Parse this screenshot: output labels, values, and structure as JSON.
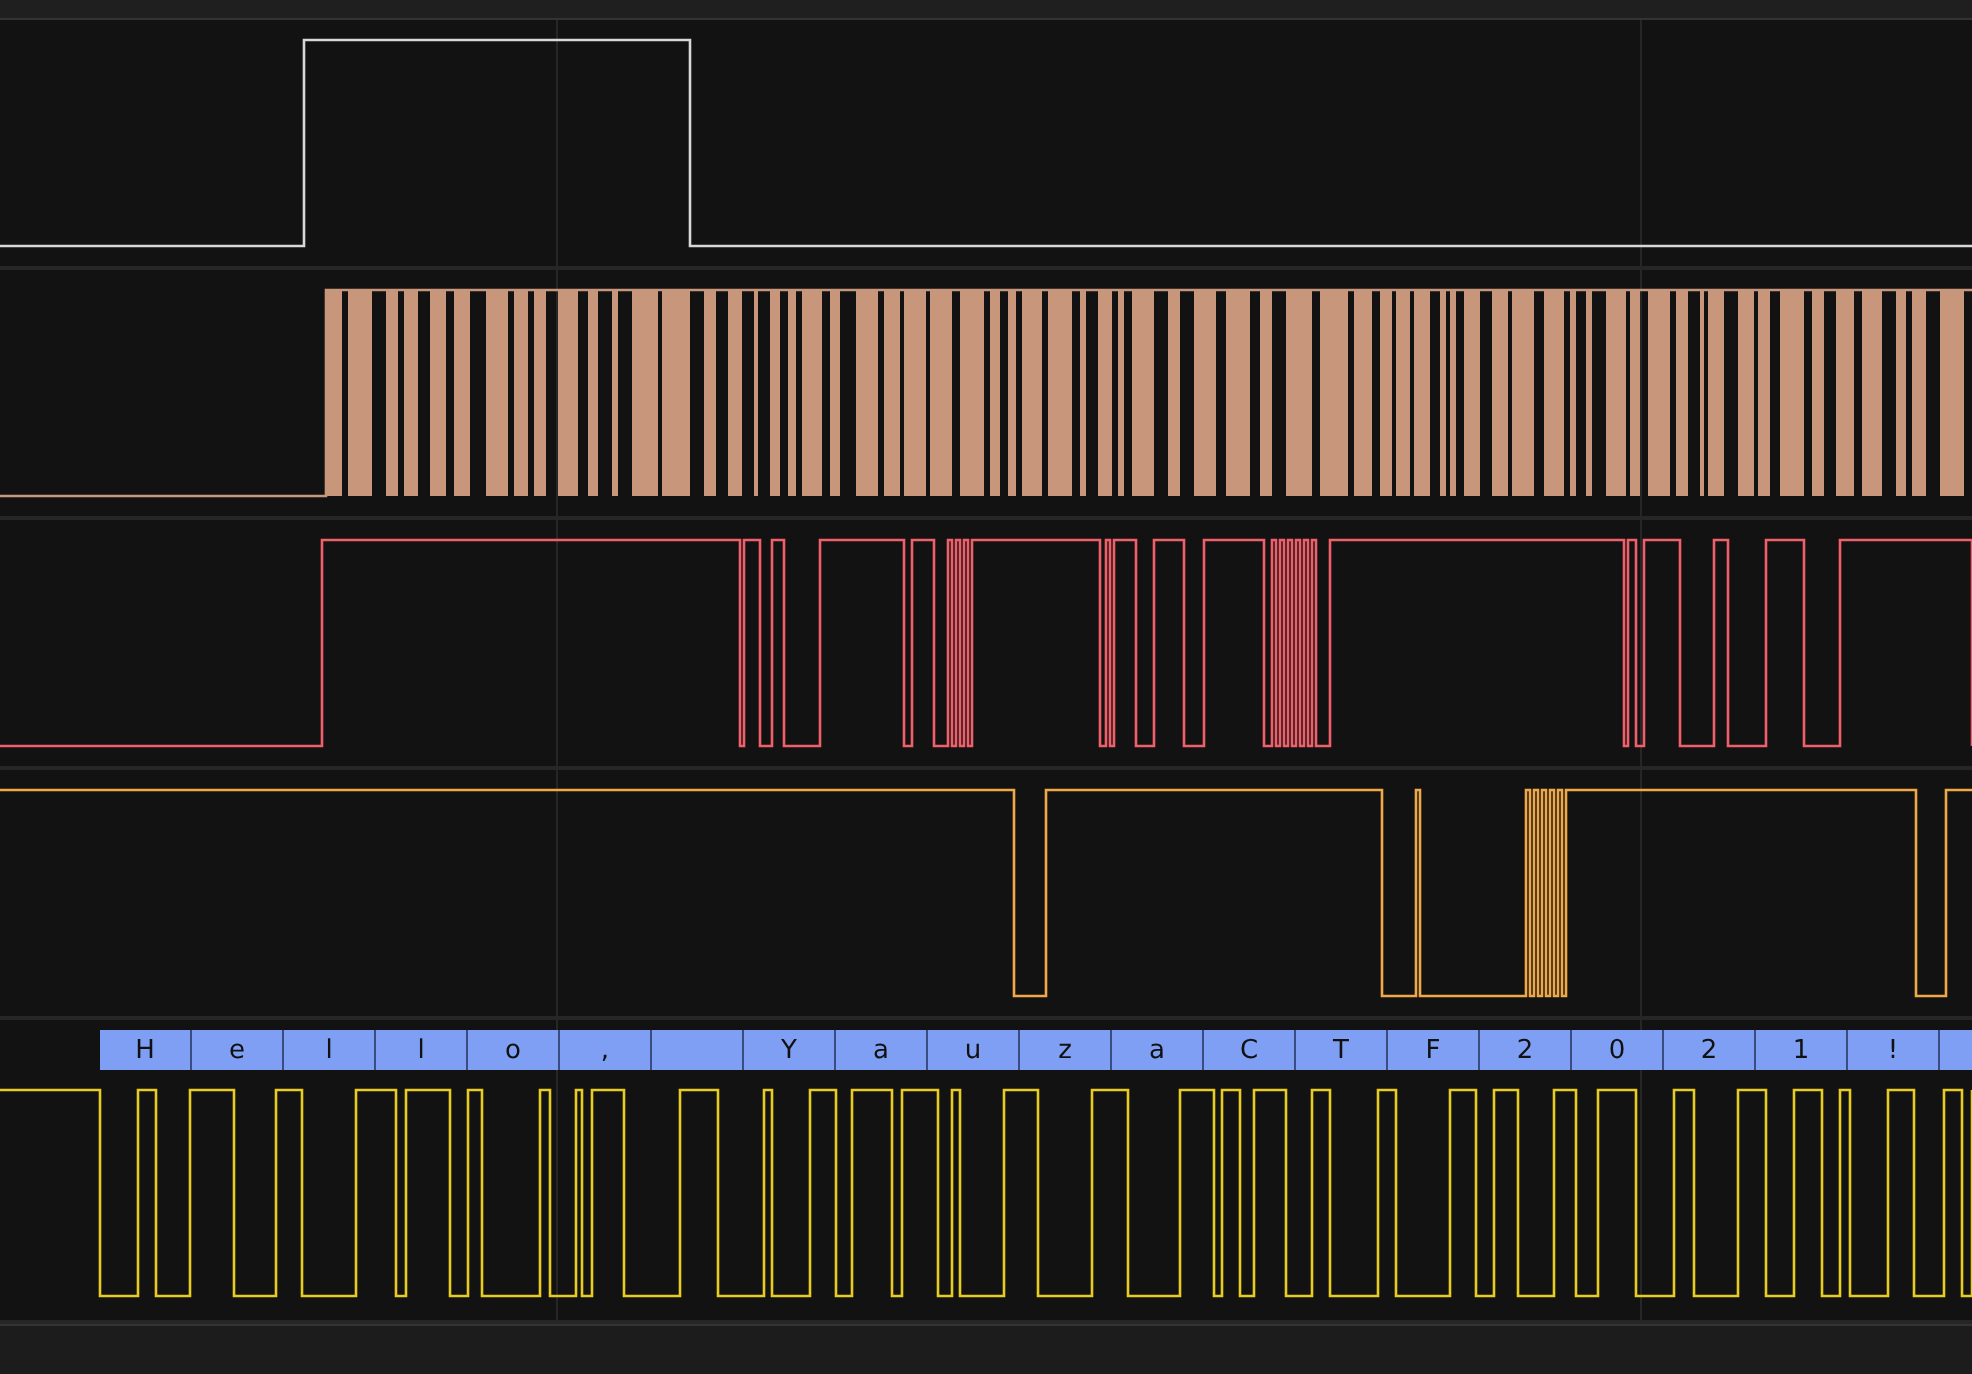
{
  "channels": [
    {
      "kind": "pulse",
      "color": "#d8d8d8"
    },
    {
      "kind": "dense",
      "color": "#c8967a"
    },
    {
      "kind": "burst",
      "color": "#f0606a"
    },
    {
      "kind": "sparse",
      "color": "#f0a848"
    },
    {
      "kind": "serial",
      "color": "#e8cc20"
    }
  ],
  "decoder": {
    "cells": [
      {
        "text": "H"
      },
      {
        "text": "e"
      },
      {
        "text": "l"
      },
      {
        "text": "l"
      },
      {
        "text": "o"
      },
      {
        "text": ","
      },
      {
        "kind": "blank"
      },
      {
        "text": "Y"
      },
      {
        "text": "a"
      },
      {
        "text": "u"
      },
      {
        "text": "z"
      },
      {
        "text": "a"
      },
      {
        "text": "C"
      },
      {
        "text": "T"
      },
      {
        "text": "F"
      },
      {
        "text": "2"
      },
      {
        "text": "0"
      },
      {
        "text": "2"
      },
      {
        "text": "1"
      },
      {
        "text": "!"
      },
      {
        "kind": "blank"
      }
    ]
  }
}
